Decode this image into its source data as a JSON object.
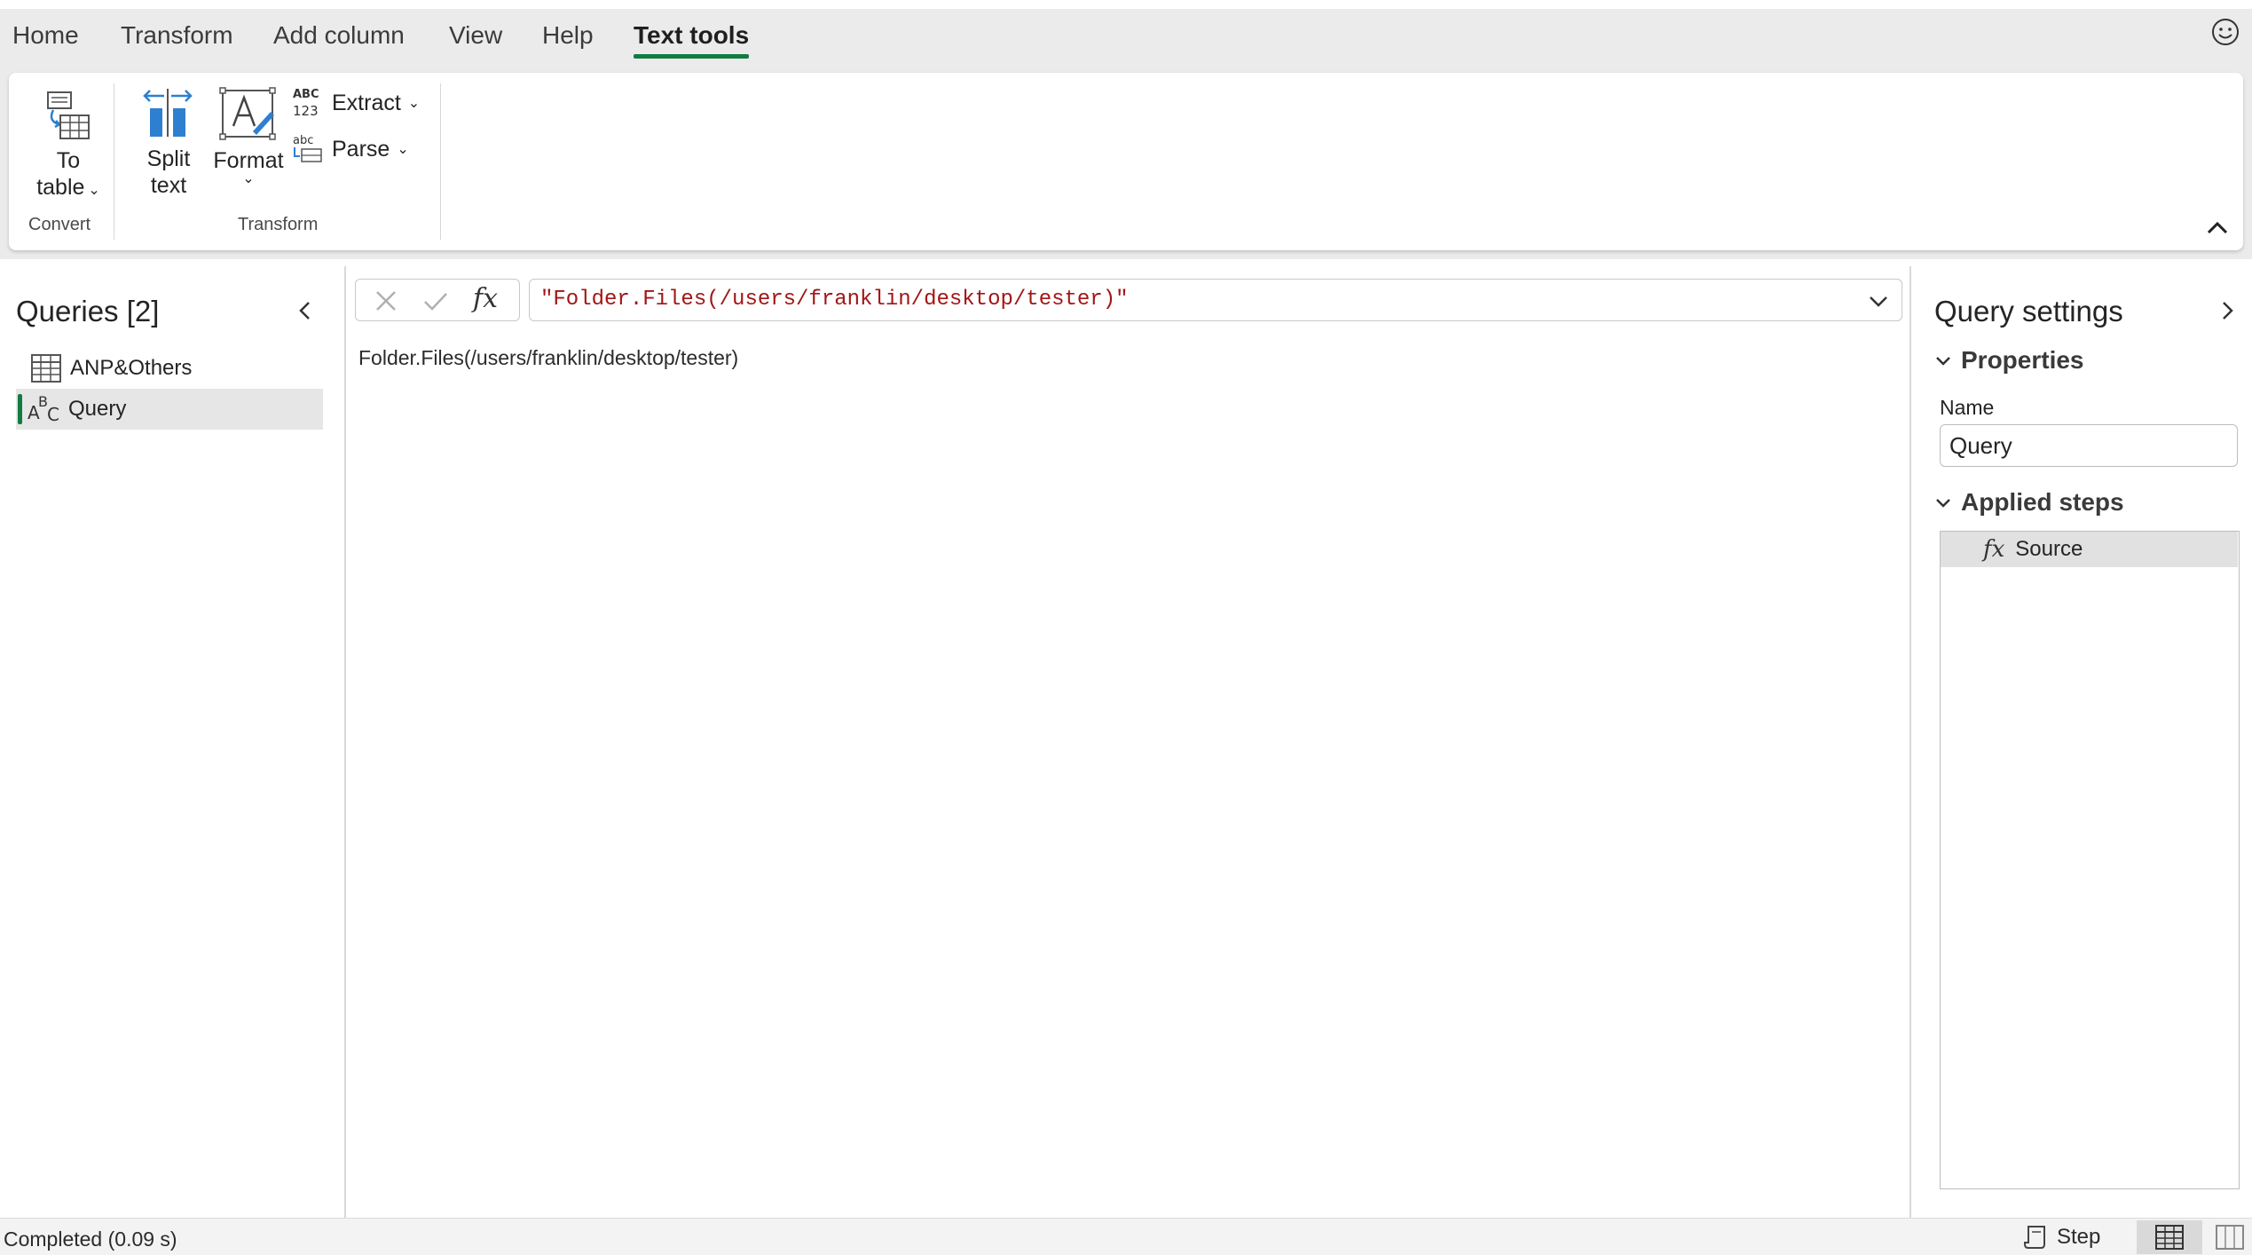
{
  "tabs": [
    {
      "label": "Home"
    },
    {
      "label": "Transform"
    },
    {
      "label": "Add column"
    },
    {
      "label": "View"
    },
    {
      "label": "Help"
    },
    {
      "label": "Text tools",
      "active": true
    }
  ],
  "ribbon": {
    "to_table": {
      "line1": "To",
      "line2": "table"
    },
    "split_text": {
      "line1": "Split",
      "line2": "text"
    },
    "format": {
      "label": "Format"
    },
    "extract": {
      "label": "Extract"
    },
    "parse": {
      "label": "Parse"
    },
    "groups": {
      "convert": "Convert",
      "transform": "Transform"
    }
  },
  "queries": {
    "title": "Queries [2]",
    "items": [
      {
        "label": "ANP&Others",
        "icon": "table-icon"
      },
      {
        "label": "Query",
        "icon": "text-type-icon",
        "selected": true
      }
    ]
  },
  "formula": {
    "text": "\"Folder.Files(/users/franklin/desktop/tester)\"",
    "fx_label": "fx"
  },
  "result": {
    "text": "Folder.Files(/users/franklin/desktop/tester)"
  },
  "settings": {
    "title": "Query settings",
    "properties_label": "Properties",
    "name_label": "Name",
    "name_value": "Query",
    "applied_steps_label": "Applied steps",
    "steps": [
      {
        "label": "Source"
      }
    ]
  },
  "status": {
    "text": "Completed (0.09 s)",
    "step_label": "Step"
  },
  "colors": {
    "accent": "#107c41",
    "formula_string": "#a31515",
    "icon_blue": "#2f7fd0"
  }
}
